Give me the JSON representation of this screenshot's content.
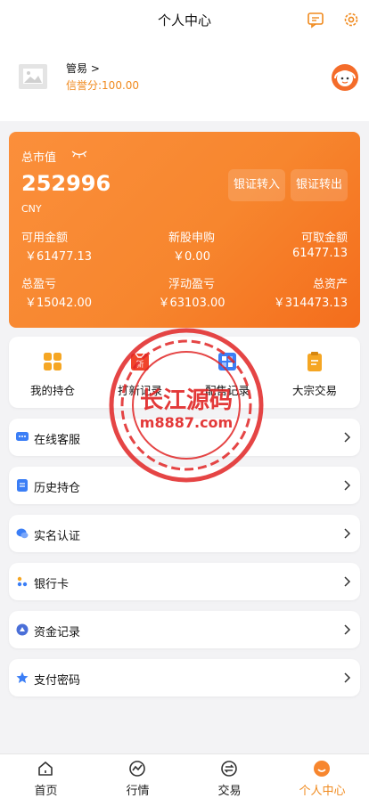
{
  "header": {
    "title": "个人中心",
    "icons": [
      "message-icon",
      "gear-icon"
    ]
  },
  "profile": {
    "username": "管易 >",
    "credit": "信誉分:100.00"
  },
  "asset_card": {
    "total_label": "总市值",
    "total_value": "252996",
    "currency": "CNY",
    "transfer_in": "银证转入",
    "transfer_out": "银证转出",
    "available_label": "可用金额",
    "available_value": "￥61477.13",
    "ipo_label": "新股申购",
    "ipo_value": "￥0.00",
    "withdrawable_label": "可取金额",
    "withdrawable_value": "61477.13",
    "total_pl_label": "总盈亏",
    "total_pl_value": "￥15042.00",
    "float_pl_label": "浮动盈亏",
    "float_pl_value": "￥63103.00",
    "total_assets_label": "总资产",
    "total_assets_value": "￥314473.13",
    "accent": "#f7862e"
  },
  "quick": {
    "items": [
      {
        "label": "我的持仓",
        "icon": "grid-icon"
      },
      {
        "label": "打新记录",
        "icon": "new-stock-icon"
      },
      {
        "label": "配售记录",
        "icon": "allotment-icon"
      },
      {
        "label": "大宗交易",
        "icon": "clipboard-icon"
      }
    ]
  },
  "menu": {
    "items": [
      {
        "label": "在线客服",
        "icon": "chat-icon"
      },
      {
        "label": "历史持仓",
        "icon": "list-icon"
      },
      {
        "label": "实名认证",
        "icon": "bubble-icon"
      },
      {
        "label": "银行卡",
        "icon": "card-icon"
      },
      {
        "label": "资金记录",
        "icon": "fund-icon"
      },
      {
        "label": "支付密码",
        "icon": "star-icon"
      }
    ]
  },
  "watermark": {
    "line1": "长江源码",
    "line2": "m8887.com"
  },
  "tabbar": {
    "tabs": [
      {
        "label": "首页",
        "icon": "home-icon"
      },
      {
        "label": "行情",
        "icon": "chart-icon"
      },
      {
        "label": "交易",
        "icon": "exchange-icon"
      },
      {
        "label": "个人中心",
        "icon": "user-face-icon"
      }
    ],
    "active_index": 3
  }
}
